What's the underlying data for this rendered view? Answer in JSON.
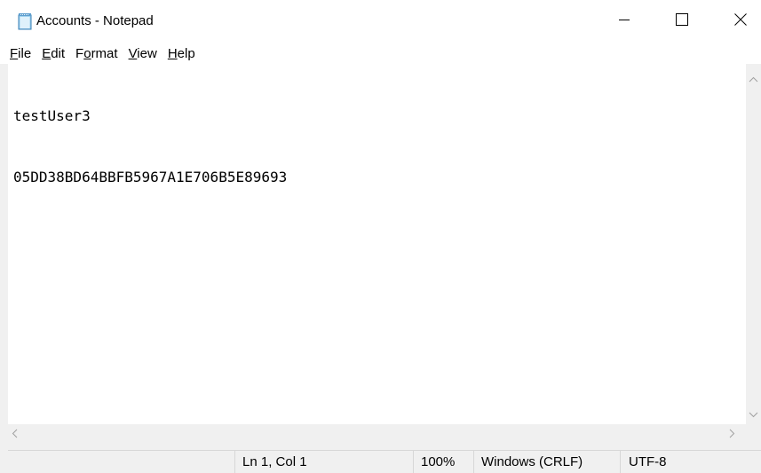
{
  "window": {
    "title": "Accounts - Notepad"
  },
  "menu": {
    "items": [
      {
        "first": "F",
        "rest": "ile"
      },
      {
        "first": "E",
        "rest": "dit"
      },
      {
        "pre": "F",
        "first": "o",
        "rest": "rmat"
      },
      {
        "first": "V",
        "rest": "iew"
      },
      {
        "first": "H",
        "rest": "elp"
      }
    ]
  },
  "editor": {
    "lines": [
      "testUser3",
      "05DD38BD64BBFB5967A1E706B5E89693"
    ]
  },
  "status": {
    "position": "Ln 1, Col 1",
    "zoom": "100%",
    "line_ending": "Windows (CRLF)",
    "encoding": "UTF-8"
  },
  "icons": {
    "app": "notepad-icon",
    "minimize": "minimize-icon",
    "maximize": "maximize-icon",
    "close": "close-icon"
  }
}
